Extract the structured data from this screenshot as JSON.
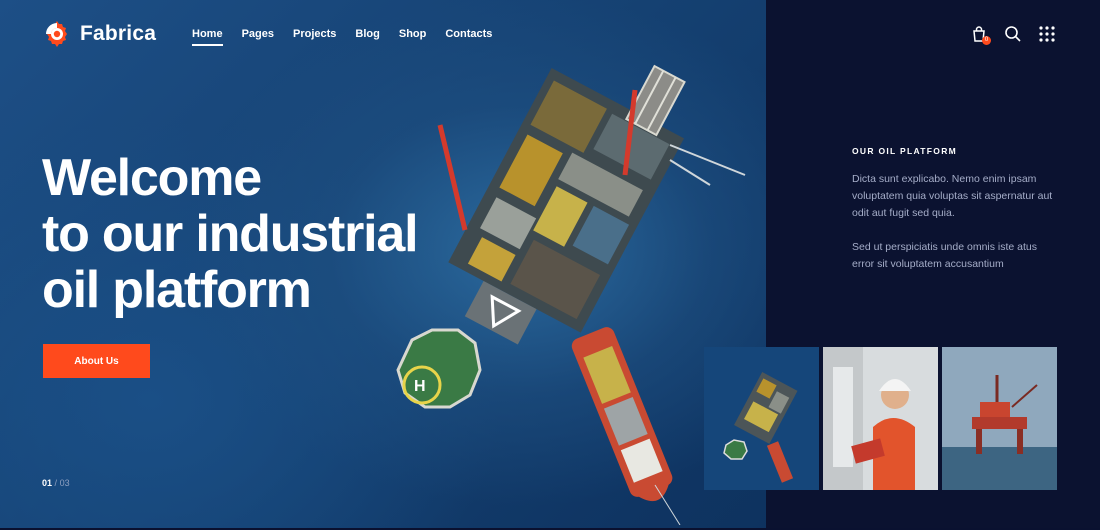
{
  "brand": {
    "name": "Fabrica"
  },
  "nav": {
    "items": [
      {
        "label": "Home",
        "active": true
      },
      {
        "label": "Pages"
      },
      {
        "label": "Projects"
      },
      {
        "label": "Blog"
      },
      {
        "label": "Shop"
      },
      {
        "label": "Contacts"
      }
    ]
  },
  "header": {
    "icons": [
      "shopping-bag-icon",
      "search-icon",
      "grid-menu-icon"
    ],
    "cart_count": "0"
  },
  "hero": {
    "headline_lines": [
      "Welcome",
      "to our industrial",
      "oil platform"
    ],
    "cta_label": "About Us",
    "pager": {
      "current": "01",
      "separator": "/",
      "total": "03"
    }
  },
  "side": {
    "label": "OUR OIL PLATFORM",
    "paragraph1": "Dicta sunt explicabo. Nemo enim ipsam voluptatem quia voluptas sit aspernatur aut odit aut fugit sed quia.",
    "paragraph2": "Sed ut perspiciatis unde omnis iste atus error sit voluptatem accusantium"
  },
  "colors": {
    "accent": "#ff4a1c",
    "panel": "#0b1230",
    "ocean": "#154172"
  }
}
